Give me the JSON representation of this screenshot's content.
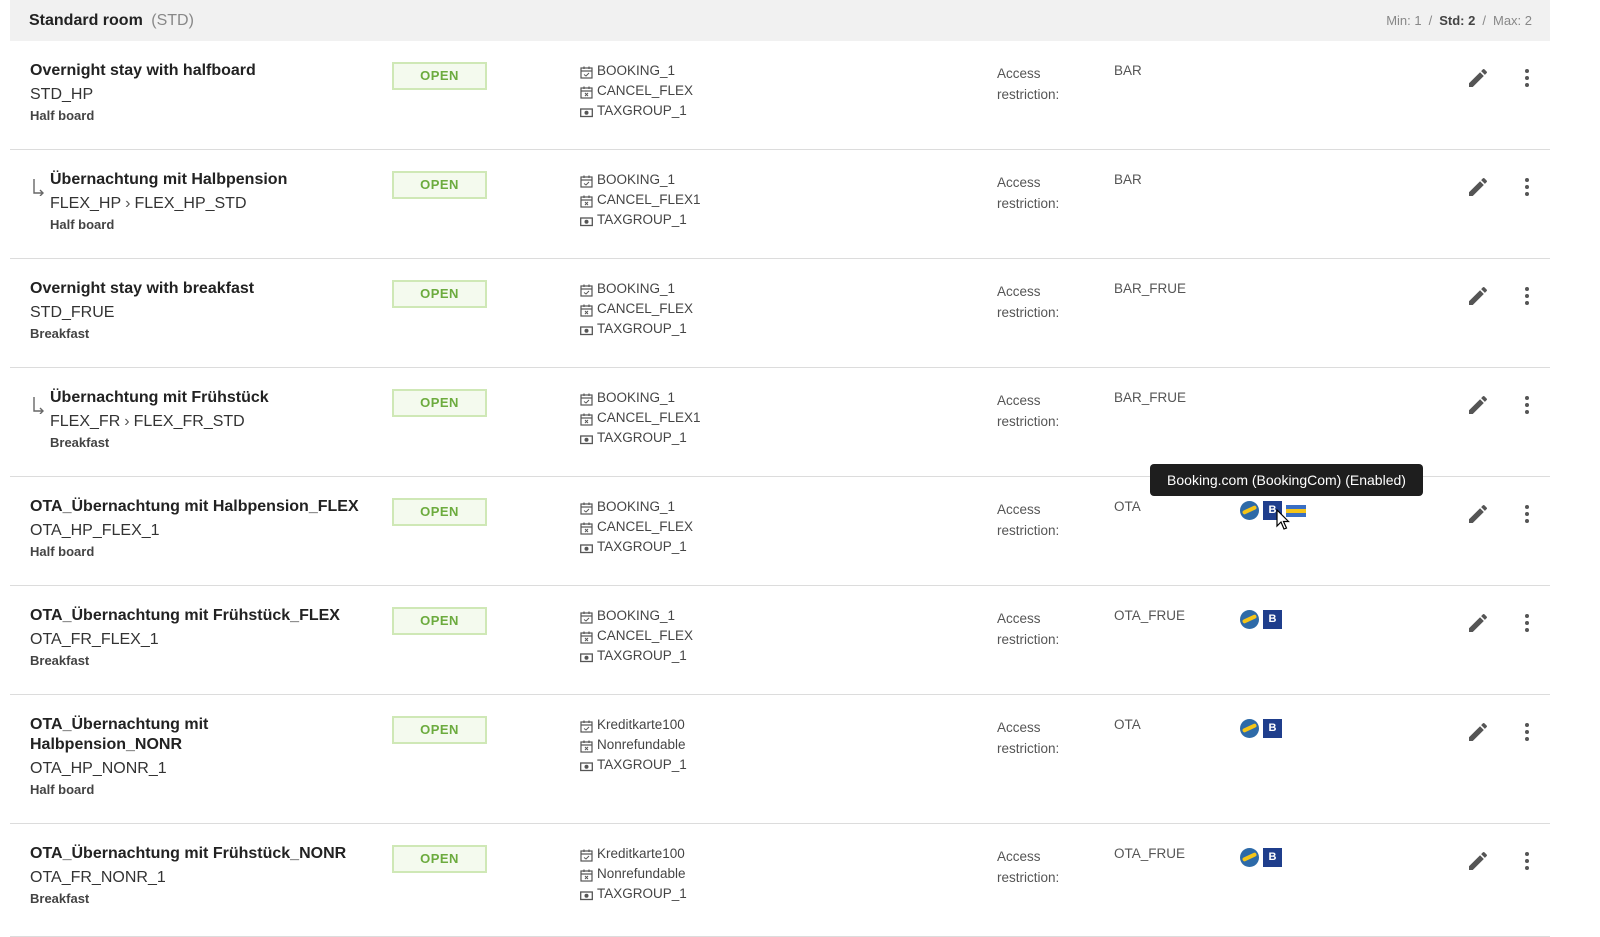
{
  "header": {
    "title": "Standard room",
    "code": "(STD)",
    "min_label": "Min: 1",
    "std_label": "Std: 2",
    "max_label": "Max: 2",
    "sep": "/"
  },
  "access_label": "Access restriction:",
  "status_label": "OPEN",
  "rows": [
    {
      "name": "Overnight stay with halfboard",
      "code": "STD_HP",
      "board": "Half board",
      "policies": [
        "BOOKING_1",
        "CANCEL_FLEX",
        "TAXGROUP_1"
      ],
      "access": "BAR"
    },
    {
      "name": "Übernachtung mit Halbpension",
      "code": "FLEX_HP",
      "code_child": "FLEX_HP_STD",
      "board": "Half board",
      "policies": [
        "BOOKING_1",
        "CANCEL_FLEX1",
        "TAXGROUP_1"
      ],
      "access": "BAR"
    },
    {
      "name": "Overnight stay with breakfast",
      "code": "STD_FRUE",
      "board": "Breakfast",
      "policies": [
        "BOOKING_1",
        "CANCEL_FLEX",
        "TAXGROUP_1"
      ],
      "access": "BAR_FRUE"
    },
    {
      "name": "Übernachtung mit Frühstück",
      "code": "FLEX_FR",
      "code_child": "FLEX_FR_STD",
      "board": "Breakfast",
      "policies": [
        "BOOKING_1",
        "CANCEL_FLEX1",
        "TAXGROUP_1"
      ],
      "access": "BAR_FRUE"
    },
    {
      "name": "OTA_Übernachtung mit Halbpension_FLEX",
      "code": "OTA_HP_FLEX_1",
      "board": "Half board",
      "policies": [
        "BOOKING_1",
        "CANCEL_FLEX",
        "TAXGROUP_1"
      ],
      "access": "OTA"
    },
    {
      "name": "OTA_Übernachtung mit Frühstück_FLEX",
      "code": "OTA_FR_FLEX_1",
      "board": "Breakfast",
      "policies": [
        "BOOKING_1",
        "CANCEL_FLEX",
        "TAXGROUP_1"
      ],
      "access": "OTA_FRUE"
    },
    {
      "name": "OTA_Übernachtung mit Halbpension_NONR",
      "name_line1": "OTA_Übernachtung mit",
      "name_line2": "Halbpension_NONR",
      "code": "OTA_HP_NONR_1",
      "board": "Half board",
      "policies": [
        "Kreditkarte100",
        "Nonrefundable",
        "TAXGROUP_1"
      ],
      "access": "OTA"
    },
    {
      "name": "OTA_Übernachtung mit Frühstück_NONR",
      "code": "OTA_FR_NONR_1",
      "board": "Breakfast",
      "policies": [
        "Kreditkarte100",
        "Nonrefundable",
        "TAXGROUP_1"
      ],
      "access": "OTA_FRUE"
    }
  ],
  "channel_booking_letter": "B",
  "tooltip": "Booking.com (BookingCom) (Enabled)",
  "colors": {
    "status_green": "#6cab3e",
    "booking_blue": "#1f3e8c",
    "expedia_blue": "#2d6aa8"
  }
}
